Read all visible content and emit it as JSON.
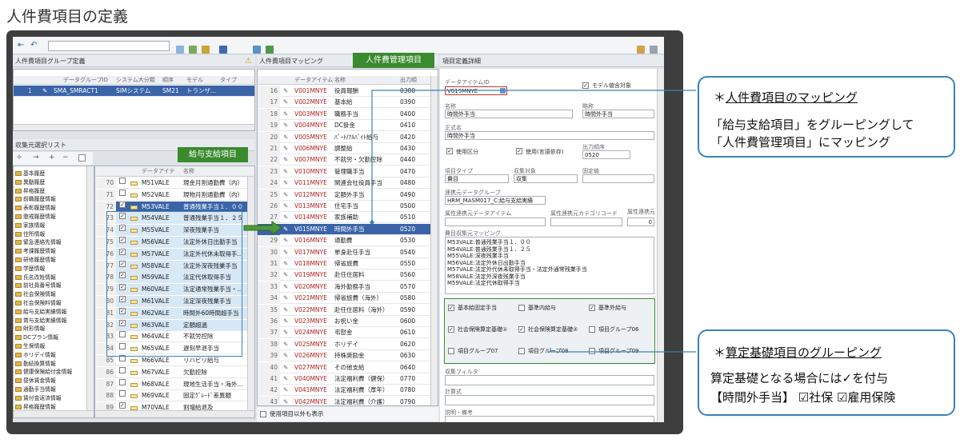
{
  "page_title": "人件費項目の定義",
  "toolbar": {
    "search_value": ""
  },
  "left_panel": {
    "title": "人件費項目グループ定義",
    "headers": [
      "データグループID",
      "システム大分類",
      "順序",
      "モデル",
      "タイプ"
    ],
    "row": {
      "num": "1",
      "id": "SMA_SMRACT1",
      "system": "SIMシステム",
      "order": "SM21",
      "model": "トランザ..."
    },
    "source_title": "収集元選択リスト",
    "tree_items": [
      "基本履歴",
      "異動履歴",
      "昇格履歴",
      "前職履歴情報",
      "表彰履歴情報",
      "懲戒履歴情報",
      "家族情報",
      "住所情報",
      "緊急連絡先情報",
      "考課履歴情報",
      "研修履歴情報",
      "学歴情報",
      "氏名改姓情報",
      "前社員番号情報",
      "社会保険情報",
      "社会保険料情報",
      "給与支給実績情報",
      "賞与支給実績情報",
      "財形情報",
      "DCプラン情報",
      "生保情報",
      "ホリデイ情報",
      "勤続換算情報",
      "健康保険給付金情報",
      "昼休賃金情報",
      "通勤手当情報",
      "賃付金返済情報",
      "昇格履歴情報"
    ]
  },
  "pay_list": {
    "label": "給与支給項目",
    "headers": [
      "データアイテ",
      "名称"
    ],
    "rows": [
      {
        "n": "70",
        "code": "M51VALE",
        "name": "現金月割通勤費（内）",
        "checked": false
      },
      {
        "n": "71",
        "code": "M52VALE",
        "name": "現物月割通勤費（内）",
        "checked": false
      },
      {
        "n": "72",
        "code": "M53VALE",
        "name": "普通残業手当１．００",
        "checked": true
      },
      {
        "n": "73",
        "code": "M54VALE",
        "name": "普通残業手当１．２５",
        "checked": true
      },
      {
        "n": "74",
        "code": "M55VALE",
        "name": "深夜残業手当",
        "checked": true
      },
      {
        "n": "75",
        "code": "M56VALE",
        "name": "法定外休日出勤手当",
        "checked": true
      },
      {
        "n": "76",
        "code": "M57VALE",
        "name": "法定外代休未取得手...",
        "checked": true
      },
      {
        "n": "77",
        "code": "M58VALE",
        "name": "法定外深夜残業手当",
        "checked": true
      },
      {
        "n": "78",
        "code": "M59VALE",
        "name": "法定代休取得手当",
        "checked": true
      },
      {
        "n": "79",
        "code": "M60VALE",
        "name": "法定通常残業手当・...",
        "checked": true
      },
      {
        "n": "80",
        "code": "M61VALE",
        "name": "法定深夜残業手当",
        "checked": true
      },
      {
        "n": "81",
        "code": "M62VALE",
        "name": "時間外60時間超手当",
        "checked": true
      },
      {
        "n": "82",
        "code": "M63VALE",
        "name": "定額超過",
        "checked": true
      },
      {
        "n": "83",
        "code": "M64VALE",
        "name": "不就労控除",
        "checked": false
      },
      {
        "n": "84",
        "code": "M65VALE",
        "name": "遅刻早退手当",
        "checked": false
      },
      {
        "n": "85",
        "code": "M66VALE",
        "name": "リハビリ給与",
        "checked": false
      },
      {
        "n": "86",
        "code": "M67VALE",
        "name": "欠勤控除",
        "checked": false
      },
      {
        "n": "87",
        "code": "M68VALE",
        "name": "現地生活手当・海外...",
        "checked": false
      },
      {
        "n": "88",
        "code": "M69VALE",
        "name": "固定ｸﾞﾚｰﾄﾞ差異額",
        "checked": false
      },
      {
        "n": "89",
        "code": "M70VALE",
        "name": "割増給退及",
        "checked": true
      }
    ]
  },
  "mapping": {
    "title": "人件費項目マッピング",
    "label": "人件費管理項目",
    "headers": [
      "データアイテム",
      "名称",
      "出力順"
    ],
    "rows": [
      {
        "n": "16",
        "code": "V001MNYE",
        "name": "役員報酬",
        "order": "0380"
      },
      {
        "n": "17",
        "code": "V002MNYE",
        "name": "基本給",
        "order": "0390"
      },
      {
        "n": "18",
        "code": "V003MNYE",
        "name": "職務手当",
        "order": "0400"
      },
      {
        "n": "19",
        "code": "V004MNYE",
        "name": "DC掛金",
        "order": "0410"
      },
      {
        "n": "20",
        "code": "V005MNYE",
        "name": "ﾊﾟｰﾄ/ｱﾙﾊﾞｲﾄ給与",
        "order": "0420"
      },
      {
        "n": "21",
        "code": "V006MNYE",
        "name": "調整給",
        "order": "0430"
      },
      {
        "n": "22",
        "code": "V007MNYE",
        "name": "不就労・欠勤控除",
        "order": "0440"
      },
      {
        "n": "23",
        "code": "V010MNYE",
        "name": "管理職手当",
        "order": "0470"
      },
      {
        "n": "24",
        "code": "V011MNYE",
        "name": "関連会社役員手当",
        "order": "0480"
      },
      {
        "n": "25",
        "code": "V012MNYE",
        "name": "定額外手当",
        "order": "0490"
      },
      {
        "n": "26",
        "code": "V013MNYE",
        "name": "住宅手当",
        "order": "0500"
      },
      {
        "n": "27",
        "code": "V014MNYE",
        "name": "家族補助",
        "order": "0510"
      },
      {
        "n": "28",
        "code": "V015MNYE",
        "name": "時間外手当",
        "order": "0520"
      },
      {
        "n": "29",
        "code": "V016MNYE",
        "name": "通勤費",
        "order": "0530"
      },
      {
        "n": "30",
        "code": "V017MNYE",
        "name": "単身赴任手当",
        "order": "0540"
      },
      {
        "n": "31",
        "code": "V018MNYE",
        "name": "帰省旅費",
        "order": "0550"
      },
      {
        "n": "32",
        "code": "V019MNYE",
        "name": "赴任住居料",
        "order": "0560"
      },
      {
        "n": "33",
        "code": "V020MNYE",
        "name": "海外勤務手当",
        "order": "0570"
      },
      {
        "n": "34",
        "code": "V021MNYE",
        "name": "帰省旅費（海外）",
        "order": "0580"
      },
      {
        "n": "35",
        "code": "V022MNYE",
        "name": "赴任住居料（海外）",
        "order": "0590"
      },
      {
        "n": "36",
        "code": "V023MNYE",
        "name": "お祝い金",
        "order": "0600"
      },
      {
        "n": "37",
        "code": "V024MNYE",
        "name": "弔慰金",
        "order": "0610"
      },
      {
        "n": "38",
        "code": "V025MNYE",
        "name": "ホリデイ",
        "order": "0620"
      },
      {
        "n": "39",
        "code": "V026MNYE",
        "name": "持株奨励金",
        "order": "0630"
      },
      {
        "n": "40",
        "code": "V027MNYE",
        "name": "その他支給",
        "order": "0640"
      },
      {
        "n": "41",
        "code": "V040MNYE",
        "name": "法定福利費（健保）",
        "order": "0770"
      },
      {
        "n": "42",
        "code": "V041MNYE",
        "name": "法定福利費（厚年）",
        "order": "0780"
      },
      {
        "n": "43",
        "code": "V042MNYE",
        "name": "法定福利費（介護）",
        "order": "0790"
      }
    ],
    "footer_checkbox": "使用項目以外も表示"
  },
  "detail": {
    "title": "項目定義詳細",
    "item_id_label": "データアイテムID",
    "item_id": "V015MNYE",
    "model_check": "モデル値含対象",
    "name_label": "名称",
    "name_value": "時間外手当",
    "abbr_label": "略称",
    "abbr_value": "時間外手当",
    "formal_label": "正式名",
    "formal_value": "時間外手当",
    "use_div": "使用区分",
    "use_lang": "使用(言語依存)",
    "out_order_label": "出力順序",
    "out_order": "0520",
    "type_label": "項目タイプ",
    "type_value": "費目",
    "collect_label": "収集対象",
    "collect_value": "収集",
    "fixed_label": "固定値",
    "source_group_label": "連携元データグループ",
    "source_group": "HRM_MASM017_C:給与支給実績",
    "attr_item_label": "属性連携元データアイテム",
    "attr_cat_label": "属性連携元カテゴリコード",
    "attr_val_label": "属性連携元",
    "attr_val": "0",
    "mapping_label": "費目収集元マッピング",
    "mapping_lines": [
      "M53VALE:普通残業手当１．００",
      "M54VALE:普通残業手当１．２５",
      "M55VALE:深夜残業手当",
      "M56VALE:法定外休日出勤手当",
      "M57VALE:法定外代休未取得手当・法定外通常残業手当",
      "M58VALE:法定外深夜残業手当",
      "M59VALE:法定代休取得手当"
    ],
    "groups": [
      {
        "label": "基本給固定手当",
        "checked": true
      },
      {
        "label": "基準内給与",
        "checked": false
      },
      {
        "label": "基準外給与",
        "checked": true
      },
      {
        "label": "社会保険算定基礎①",
        "checked": true
      },
      {
        "label": "社会保険算定基礎②",
        "checked": true
      },
      {
        "label": "項目グループ06",
        "checked": false
      },
      {
        "label": "項目グループ07",
        "checked": false
      },
      {
        "label": "項目グループ08",
        "checked": false
      },
      {
        "label": "項目グループ09",
        "checked": false
      }
    ],
    "filter_label": "収集フィルタ",
    "calc_label": "計算式",
    "memo_label": "説明・備考"
  },
  "callouts": {
    "mapping": {
      "title": "人件費項目のマッピング",
      "line1": "「給与支給項目」をグルーピングして",
      "line2": "「人件費管理項目」にマッピング"
    },
    "grouping": {
      "title": "算定基礎項目のグルーピング",
      "line1": "算定基礎となる場合には✓を付与",
      "line2": "【時間外手当】 ☑社保 ☑雇用保険"
    }
  },
  "colors": {
    "accent": "#3a8a2e",
    "callout_border": "#3a82b5",
    "highlight": "#d7e8f7",
    "select": "#3b64a8"
  }
}
